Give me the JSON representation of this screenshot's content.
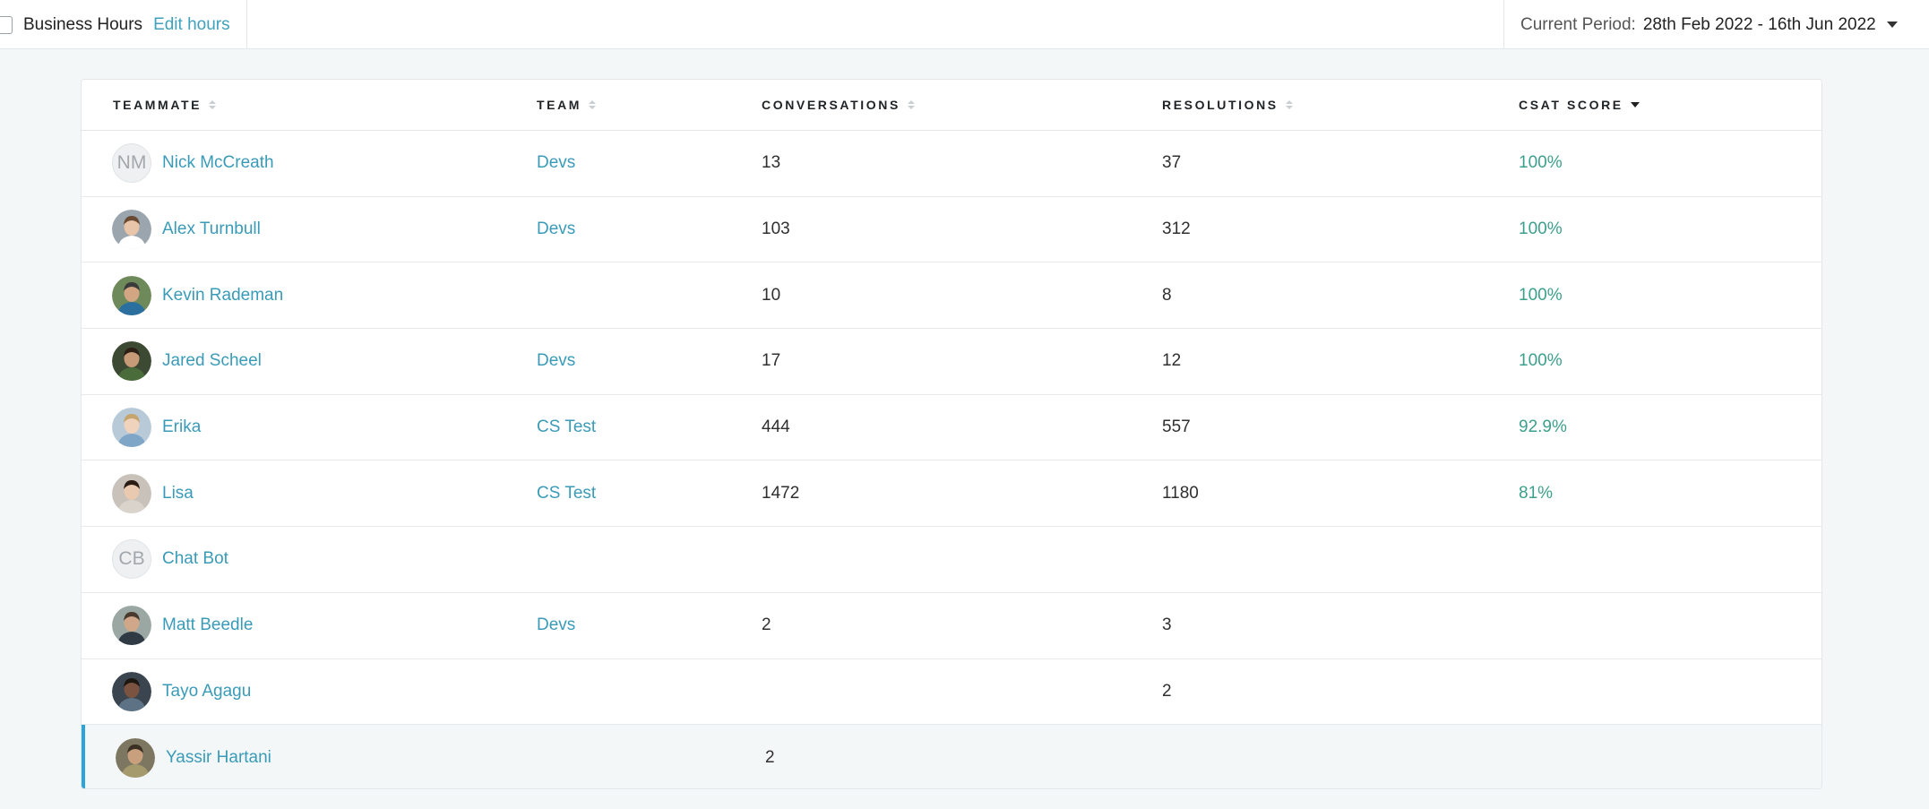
{
  "topbar": {
    "business_hours_label": "Business Hours",
    "edit_hours_label": "Edit hours",
    "period_label": "Current Period:",
    "period_value": "28th Feb 2022 - 16th Jun 2022"
  },
  "table": {
    "columns": {
      "teammate": "TEAMMATE",
      "team": "TEAM",
      "conversations": "CONVERSATIONS",
      "resolutions": "RESOLUTIONS",
      "csat": "CSAT SCORE"
    },
    "rows": [
      {
        "initials": "NM",
        "avatar": "initials",
        "name": "Nick McCreath",
        "team": "Devs",
        "conversations": "13",
        "resolutions": "37",
        "csat": "100%"
      },
      {
        "initials": "",
        "avatar": "photo-man-light",
        "name": "Alex Turnbull",
        "team": "Devs",
        "conversations": "103",
        "resolutions": "312",
        "csat": "100%"
      },
      {
        "initials": "",
        "avatar": "photo-man-sunglasses",
        "name": "Kevin Rademan",
        "team": "",
        "conversations": "10",
        "resolutions": "8",
        "csat": "100%"
      },
      {
        "initials": "",
        "avatar": "photo-man-beard-glasses",
        "name": "Jared Scheel",
        "team": "Devs",
        "conversations": "17",
        "resolutions": "12",
        "csat": "100%"
      },
      {
        "initials": "",
        "avatar": "photo-woman-blonde",
        "name": "Erika",
        "team": "CS Test",
        "conversations": "444",
        "resolutions": "557",
        "csat": "92.9%"
      },
      {
        "initials": "",
        "avatar": "photo-woman-dark-hair",
        "name": "Lisa",
        "team": "CS Test",
        "conversations": "1472",
        "resolutions": "1180",
        "csat": "81%"
      },
      {
        "initials": "CB",
        "avatar": "initials",
        "name": "Chat Bot",
        "team": "",
        "conversations": "",
        "resolutions": "",
        "csat": ""
      },
      {
        "initials": "",
        "avatar": "photo-man-bald-beard",
        "name": "Matt Beedle",
        "team": "Devs",
        "conversations": "2",
        "resolutions": "3",
        "csat": ""
      },
      {
        "initials": "",
        "avatar": "photo-man-dark",
        "name": "Tayo Agagu",
        "team": "",
        "conversations": "",
        "resolutions": "2",
        "csat": ""
      },
      {
        "initials": "",
        "avatar": "photo-man-cap",
        "name": "Yassir Hartani",
        "team": "",
        "conversations": "2",
        "resolutions": "",
        "csat": ""
      }
    ]
  },
  "colors": {
    "link": "#3a9bb8",
    "csat": "#3c9f8c",
    "selected_accent": "#2aa5d8"
  }
}
